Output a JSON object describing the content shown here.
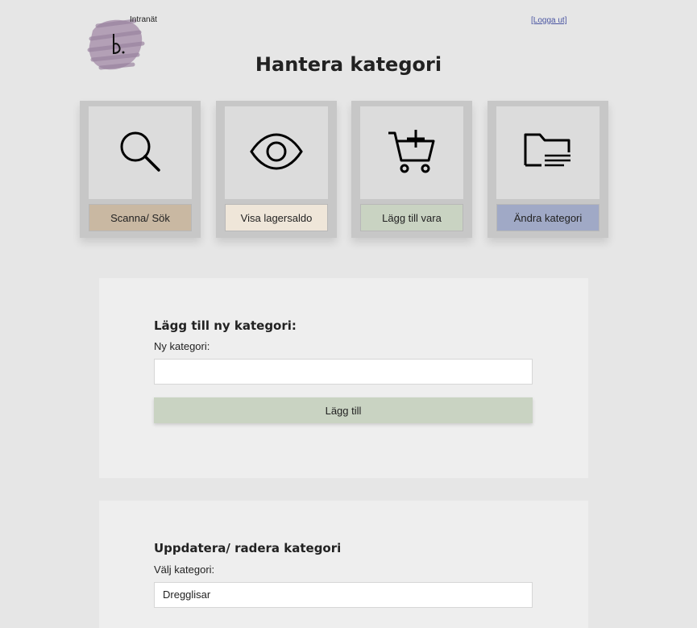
{
  "header": {
    "logo_label": "Intranät",
    "logout_label": "[Logga ut]",
    "title": "Hantera kategori"
  },
  "tiles": [
    {
      "label": "Scanna/ Sök",
      "icon": "search-icon",
      "color": "#c9b8a2"
    },
    {
      "label": "Visa lagersaldo",
      "icon": "eye-icon",
      "color": "#efe6d9"
    },
    {
      "label": "Lägg till vara",
      "icon": "cart-add-icon",
      "color": "#c9d3c2"
    },
    {
      "label": "Ändra kategori",
      "icon": "folder-icon",
      "color": "#a0a9c6"
    }
  ],
  "add_category": {
    "heading": "Lägg till ny kategori:",
    "field_label": "Ny kategori:",
    "value": "",
    "button_label": "Lägg till"
  },
  "update_category": {
    "heading": "Uppdatera/ radera kategori",
    "field_label": "Välj kategori:",
    "selected": "Dregglisar"
  }
}
